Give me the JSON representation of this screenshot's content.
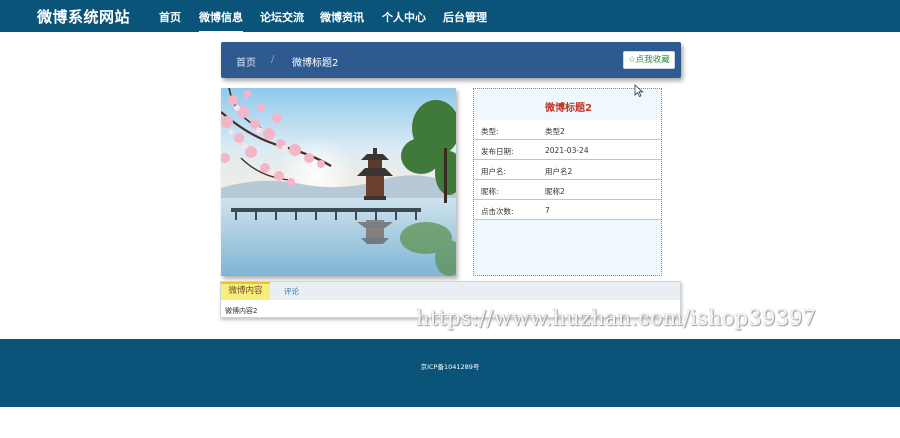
{
  "brand": "微博系统网站",
  "nav": [
    {
      "label": "首页"
    },
    {
      "label": "微博信息"
    },
    {
      "label": "论坛交流"
    },
    {
      "label": "微博资讯"
    },
    {
      "label": "个人中心"
    },
    {
      "label": "后台管理"
    }
  ],
  "nav_active": "微博信息",
  "breadcrumb": {
    "home": "首页",
    "sep": "/",
    "current": "微博标题2"
  },
  "favorite_button": "☆点我收藏",
  "detail": {
    "title": "微博标题2",
    "rows": [
      {
        "label": "类型:",
        "value": "类型2"
      },
      {
        "label": "发布日期:",
        "value": "2021-03-24"
      },
      {
        "label": "用户名:",
        "value": "用户名2"
      },
      {
        "label": "昵称:",
        "value": "昵称2"
      },
      {
        "label": "点击次数:",
        "value": "7"
      }
    ]
  },
  "tabs": {
    "active": "微博内容",
    "other": "评论",
    "content": "微博内容2"
  },
  "watermark": "https://www.huzhan.com/ishop39397",
  "footer": "京ICP备1041289号",
  "colors": {
    "nav_bg": "#0b5479",
    "header_bar": "#2e5a8f",
    "title_red": "#c0392b",
    "tab_yellow": "#f6ef7a"
  }
}
